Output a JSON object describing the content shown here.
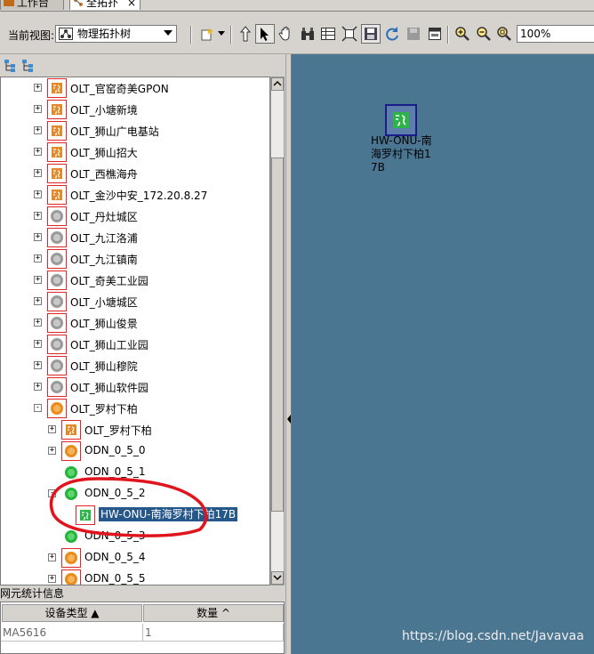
{
  "tabs": [
    {
      "label": "工作台"
    },
    {
      "label": "全拓扑",
      "close": "×"
    }
  ],
  "toolbar": {
    "view_label": "当前视图:",
    "view_value": "物理拓扑树",
    "zoom_value": "100%"
  },
  "tree": {
    "items": [
      {
        "label": "OLT_官窑奇美GPON",
        "icon": "olt-icon",
        "expander": "+",
        "level": 0
      },
      {
        "label": "OLT_小塘新境",
        "icon": "olt-icon",
        "expander": "+",
        "level": 0
      },
      {
        "label": "OLT_狮山广电基站",
        "icon": "olt-icon",
        "expander": "+",
        "level": 0
      },
      {
        "label": "OLT_狮山招大",
        "icon": "olt-icon",
        "expander": "+",
        "level": 0
      },
      {
        "label": "OLT_西樵海舟",
        "icon": "olt-icon",
        "expander": "+",
        "level": 0
      },
      {
        "label": "OLT_金沙中安_172.20.8.27",
        "icon": "olt-icon",
        "expander": "+",
        "level": 0
      },
      {
        "label": "OLT_丹灶城区",
        "icon": "gray-node-icon",
        "expander": "+",
        "level": 0
      },
      {
        "label": "OLT_九江洛浦",
        "icon": "gray-node-icon",
        "expander": "+",
        "level": 0
      },
      {
        "label": "OLT_九江镇南",
        "icon": "gray-node-icon",
        "expander": "+",
        "level": 0
      },
      {
        "label": "OLT_奇美工业园",
        "icon": "gray-node-icon",
        "expander": "+",
        "level": 0
      },
      {
        "label": "OLT_小塘城区",
        "icon": "gray-node-icon",
        "expander": "+",
        "level": 0
      },
      {
        "label": "OLT_狮山俊景",
        "icon": "gray-node-icon",
        "expander": "+",
        "level": 0
      },
      {
        "label": "OLT_狮山工业园",
        "icon": "gray-node-icon",
        "expander": "+",
        "level": 0
      },
      {
        "label": "OLT_狮山穆院",
        "icon": "gray-node-icon",
        "expander": "+",
        "level": 0
      },
      {
        "label": "OLT_狮山软件园",
        "icon": "gray-node-icon",
        "expander": "+",
        "level": 0
      },
      {
        "label": "OLT_罗村下柏",
        "icon": "orange-node-icon",
        "expander": "-",
        "level": 0
      },
      {
        "label": "OLT_罗村下柏",
        "icon": "olt-icon",
        "expander": "+",
        "level": 1
      },
      {
        "label": "ODN_0_5_0",
        "icon": "orange-node-icon",
        "expander": "+",
        "level": 1
      },
      {
        "label": "ODN_0_5_1",
        "icon": "green-node-icon",
        "expander": "",
        "level": 1
      },
      {
        "label": "ODN_0_5_2",
        "icon": "green-node-icon",
        "expander": "-",
        "level": 1
      },
      {
        "label": "HW-ONU-南海罗村下柏17B",
        "icon": "onu-icon",
        "expander": "",
        "level": 2,
        "selected": true
      },
      {
        "label": "ODN_0_5_3",
        "icon": "green-node-icon",
        "expander": "",
        "level": 1
      },
      {
        "label": "ODN_0_5_4",
        "icon": "orange-node-icon",
        "expander": "+",
        "level": 1
      },
      {
        "label": "ODN_0_5_5",
        "icon": "orange-node-icon",
        "expander": "+",
        "level": 1
      }
    ]
  },
  "stats": {
    "title": "网元统计信息",
    "columns": [
      "设备类型 ▲",
      "数量 ^"
    ],
    "rows": [
      [
        "MA5616",
        "1"
      ]
    ]
  },
  "canvas": {
    "node_label": "HW-ONU-南海罗村下柏17B"
  },
  "watermark": "https://blog.csdn.net/Javavaa",
  "colors": {
    "canvas_bg": "#4b7692",
    "selection": "#26578a",
    "annotation": "#e0141c"
  }
}
